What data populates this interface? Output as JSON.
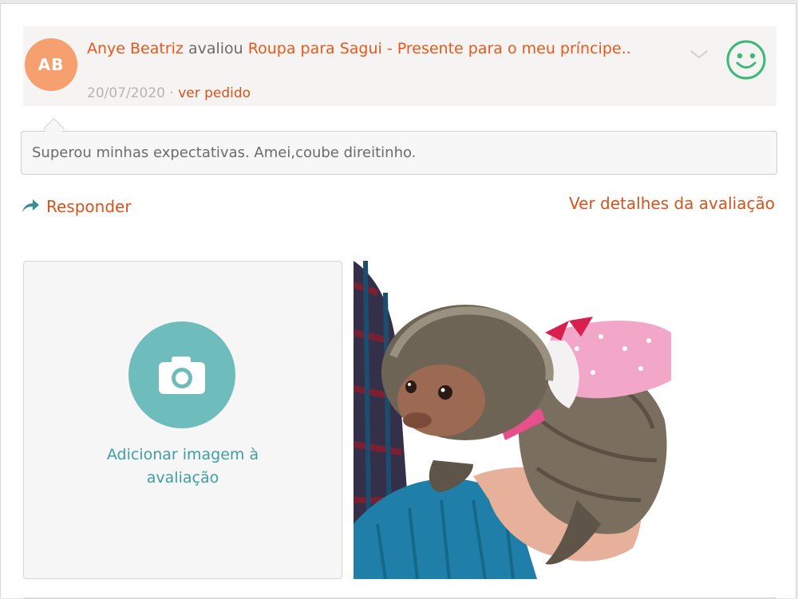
{
  "review": {
    "avatar_initials": "AB",
    "reviewer_name": "Anye Beatriz",
    "verb": "avaliou",
    "product_title": "Roupa para Sagui - Presente para o meu príncipe..",
    "date": "20/07/2020",
    "separator": " · ",
    "order_link": "ver pedido",
    "rating_icon": "smiley-happy-icon",
    "comment": "Superou minhas expectativas. Amei,coube direitinho."
  },
  "actions": {
    "reply_label": "Responder",
    "details_label": "Ver detalhes da avaliação"
  },
  "media": {
    "add_image_label": "Adicionar imagem à avaliação",
    "photo_subject": "marmoset wearing pink polka-dot outfit"
  },
  "colors": {
    "accent": "#d6531c",
    "teal": "#6fbcbc",
    "avatar": "#f5a06e",
    "smiley": "#3cb878"
  }
}
